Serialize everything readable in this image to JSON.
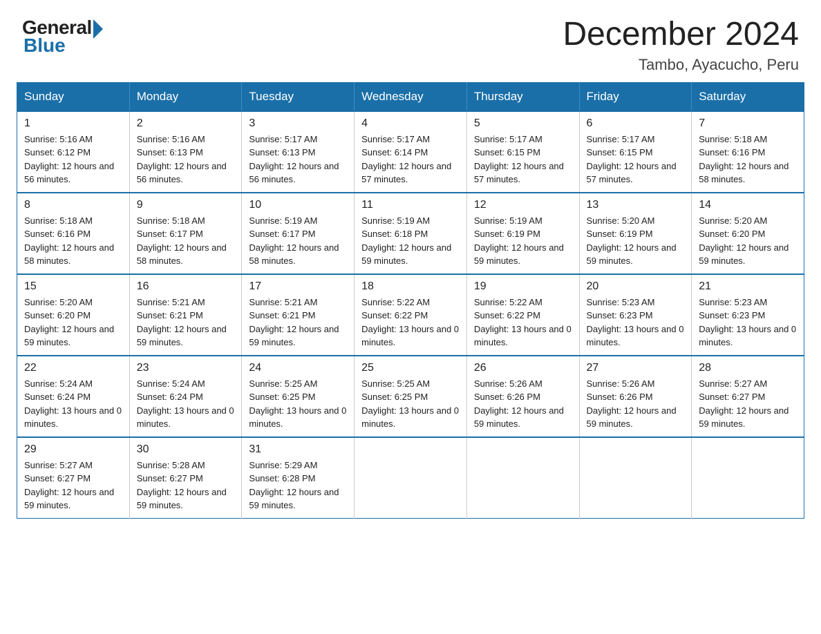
{
  "logo": {
    "general": "General",
    "blue": "Blue"
  },
  "title": "December 2024",
  "location": "Tambo, Ayacucho, Peru",
  "days_of_week": [
    "Sunday",
    "Monday",
    "Tuesday",
    "Wednesday",
    "Thursday",
    "Friday",
    "Saturday"
  ],
  "weeks": [
    [
      {
        "day": "1",
        "sunrise": "5:16 AM",
        "sunset": "6:12 PM",
        "daylight": "12 hours and 56 minutes."
      },
      {
        "day": "2",
        "sunrise": "5:16 AM",
        "sunset": "6:13 PM",
        "daylight": "12 hours and 56 minutes."
      },
      {
        "day": "3",
        "sunrise": "5:17 AM",
        "sunset": "6:13 PM",
        "daylight": "12 hours and 56 minutes."
      },
      {
        "day": "4",
        "sunrise": "5:17 AM",
        "sunset": "6:14 PM",
        "daylight": "12 hours and 57 minutes."
      },
      {
        "day": "5",
        "sunrise": "5:17 AM",
        "sunset": "6:15 PM",
        "daylight": "12 hours and 57 minutes."
      },
      {
        "day": "6",
        "sunrise": "5:17 AM",
        "sunset": "6:15 PM",
        "daylight": "12 hours and 57 minutes."
      },
      {
        "day": "7",
        "sunrise": "5:18 AM",
        "sunset": "6:16 PM",
        "daylight": "12 hours and 58 minutes."
      }
    ],
    [
      {
        "day": "8",
        "sunrise": "5:18 AM",
        "sunset": "6:16 PM",
        "daylight": "12 hours and 58 minutes."
      },
      {
        "day": "9",
        "sunrise": "5:18 AM",
        "sunset": "6:17 PM",
        "daylight": "12 hours and 58 minutes."
      },
      {
        "day": "10",
        "sunrise": "5:19 AM",
        "sunset": "6:17 PM",
        "daylight": "12 hours and 58 minutes."
      },
      {
        "day": "11",
        "sunrise": "5:19 AM",
        "sunset": "6:18 PM",
        "daylight": "12 hours and 59 minutes."
      },
      {
        "day": "12",
        "sunrise": "5:19 AM",
        "sunset": "6:19 PM",
        "daylight": "12 hours and 59 minutes."
      },
      {
        "day": "13",
        "sunrise": "5:20 AM",
        "sunset": "6:19 PM",
        "daylight": "12 hours and 59 minutes."
      },
      {
        "day": "14",
        "sunrise": "5:20 AM",
        "sunset": "6:20 PM",
        "daylight": "12 hours and 59 minutes."
      }
    ],
    [
      {
        "day": "15",
        "sunrise": "5:20 AM",
        "sunset": "6:20 PM",
        "daylight": "12 hours and 59 minutes."
      },
      {
        "day": "16",
        "sunrise": "5:21 AM",
        "sunset": "6:21 PM",
        "daylight": "12 hours and 59 minutes."
      },
      {
        "day": "17",
        "sunrise": "5:21 AM",
        "sunset": "6:21 PM",
        "daylight": "12 hours and 59 minutes."
      },
      {
        "day": "18",
        "sunrise": "5:22 AM",
        "sunset": "6:22 PM",
        "daylight": "13 hours and 0 minutes."
      },
      {
        "day": "19",
        "sunrise": "5:22 AM",
        "sunset": "6:22 PM",
        "daylight": "13 hours and 0 minutes."
      },
      {
        "day": "20",
        "sunrise": "5:23 AM",
        "sunset": "6:23 PM",
        "daylight": "13 hours and 0 minutes."
      },
      {
        "day": "21",
        "sunrise": "5:23 AM",
        "sunset": "6:23 PM",
        "daylight": "13 hours and 0 minutes."
      }
    ],
    [
      {
        "day": "22",
        "sunrise": "5:24 AM",
        "sunset": "6:24 PM",
        "daylight": "13 hours and 0 minutes."
      },
      {
        "day": "23",
        "sunrise": "5:24 AM",
        "sunset": "6:24 PM",
        "daylight": "13 hours and 0 minutes."
      },
      {
        "day": "24",
        "sunrise": "5:25 AM",
        "sunset": "6:25 PM",
        "daylight": "13 hours and 0 minutes."
      },
      {
        "day": "25",
        "sunrise": "5:25 AM",
        "sunset": "6:25 PM",
        "daylight": "13 hours and 0 minutes."
      },
      {
        "day": "26",
        "sunrise": "5:26 AM",
        "sunset": "6:26 PM",
        "daylight": "12 hours and 59 minutes."
      },
      {
        "day": "27",
        "sunrise": "5:26 AM",
        "sunset": "6:26 PM",
        "daylight": "12 hours and 59 minutes."
      },
      {
        "day": "28",
        "sunrise": "5:27 AM",
        "sunset": "6:27 PM",
        "daylight": "12 hours and 59 minutes."
      }
    ],
    [
      {
        "day": "29",
        "sunrise": "5:27 AM",
        "sunset": "6:27 PM",
        "daylight": "12 hours and 59 minutes."
      },
      {
        "day": "30",
        "sunrise": "5:28 AM",
        "sunset": "6:27 PM",
        "daylight": "12 hours and 59 minutes."
      },
      {
        "day": "31",
        "sunrise": "5:29 AM",
        "sunset": "6:28 PM",
        "daylight": "12 hours and 59 minutes."
      },
      null,
      null,
      null,
      null
    ]
  ]
}
